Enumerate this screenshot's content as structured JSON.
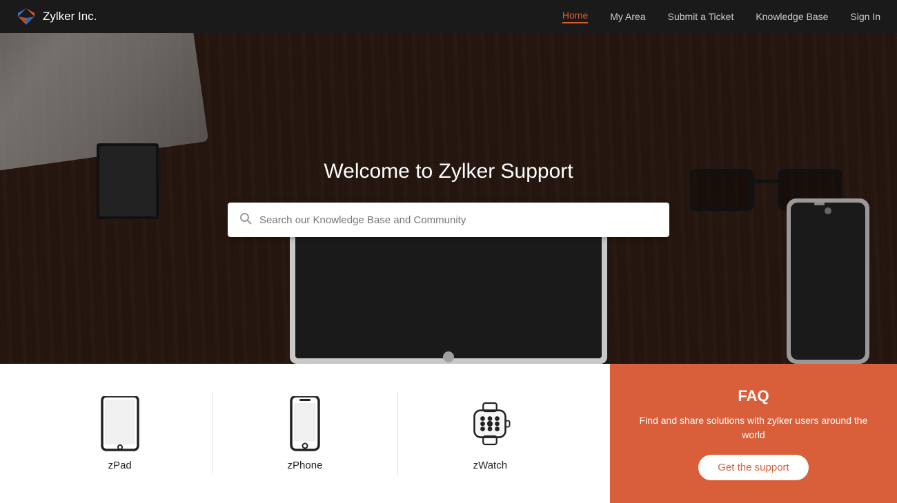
{
  "navbar": {
    "brand_name": "Zylker Inc.",
    "links": [
      {
        "label": "Home",
        "active": true
      },
      {
        "label": "My Area",
        "active": false
      },
      {
        "label": "Submit a Ticket",
        "active": false
      },
      {
        "label": "Knowledge Base",
        "active": false
      },
      {
        "label": "Sign In",
        "active": false
      }
    ]
  },
  "hero": {
    "title": "Welcome to Zylker Support",
    "search_placeholder": "Search our Knowledge Base and Community"
  },
  "products": [
    {
      "id": "zpad",
      "label": "zPad",
      "icon": "tablet"
    },
    {
      "id": "zphone",
      "label": "zPhone",
      "icon": "phone"
    },
    {
      "id": "zwatch",
      "label": "zWatch",
      "icon": "watch"
    }
  ],
  "faq": {
    "title": "FAQ",
    "description": "Find and share solutions with zylker users around the world",
    "button_label": "Get the support"
  }
}
